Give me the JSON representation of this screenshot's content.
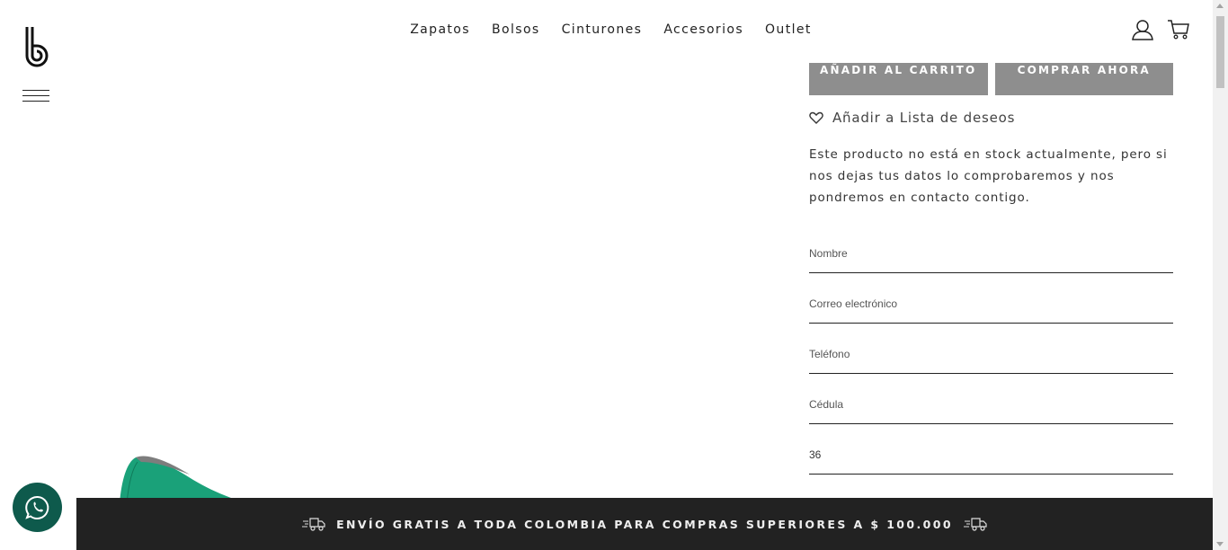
{
  "header": {
    "nav": [
      "Zapatos",
      "Bolsos",
      "Cinturones",
      "Accesorios",
      "Outlet"
    ]
  },
  "product": {
    "add_to_cart_label": "AÑADIR AL CARRITO",
    "buy_now_label": "COMPRAR AHORA",
    "wishlist_label": "Añadir a Lista de deseos",
    "stock_message": "Este producto no está en stock actualmente, pero si nos dejas tus datos lo comprobaremos y nos pondremos en contacto contigo."
  },
  "form": {
    "name_placeholder": "Nombre",
    "email_placeholder": "Correo electrónico",
    "phone_placeholder": "Teléfono",
    "id_placeholder": "Cédula",
    "size_value": "36"
  },
  "shipping_bar": {
    "text": "ENVÍO GRATIS A TODA COLOMBIA PARA COMPRAS SUPERIORES A $ 100.000"
  },
  "colors": {
    "button_gray": "#8e8e8e",
    "bar_dark": "#222222",
    "whatsapp_green": "#0e5a4c",
    "shoe_green": "#1aa179"
  },
  "icons": {
    "logo": "brand-b-logo",
    "menu": "hamburger-icon",
    "account": "user-icon",
    "cart": "cart-icon",
    "wishlist": "heart-icon",
    "shipping": "truck-icon",
    "chat": "whatsapp-icon"
  }
}
